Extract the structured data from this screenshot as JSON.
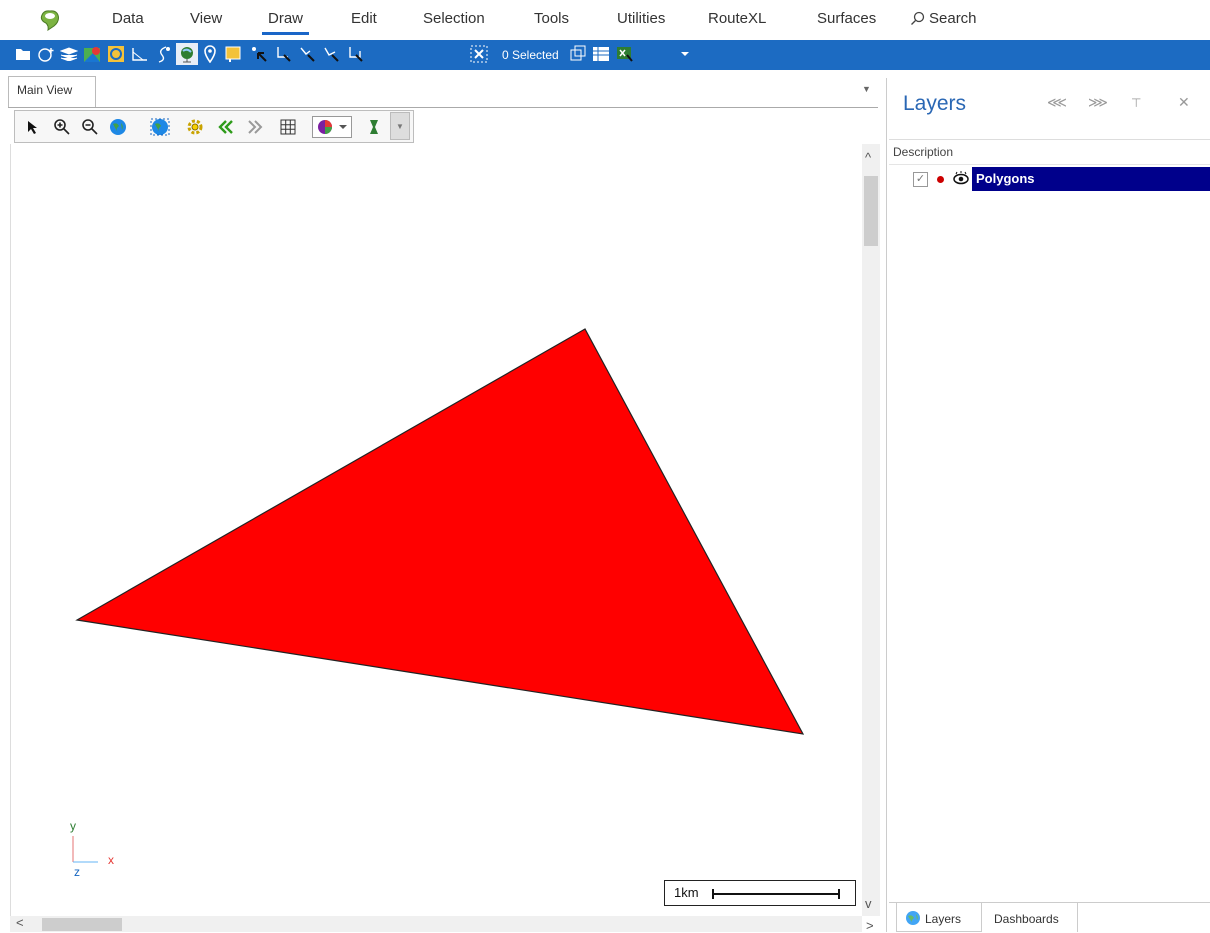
{
  "menu": {
    "items": [
      "Data",
      "View",
      "Draw",
      "Edit",
      "Selection",
      "Tools",
      "Utilities",
      "RouteXL",
      "Surfaces"
    ],
    "active": "Draw",
    "search_label": "Search"
  },
  "toolbar": {
    "selected_label": "0 Selected",
    "icons": [
      "open-folder-icon",
      "add-layer-icon",
      "layers-stack-icon",
      "map-pin-layer-icon",
      "frame-icon",
      "measure-icon",
      "route-icon",
      "globe-icon",
      "location-pin-icon",
      "polygon-tool-icon",
      "select-point-icon",
      "select-polyline-icon",
      "select-vertex-icon",
      "select-lasso-icon",
      "select-area-icon",
      "clear-selection-icon",
      "copy-selection-icon",
      "table-icon",
      "export-excel-icon",
      "toolbar-dropdown-icon"
    ]
  },
  "main_view": {
    "tab_label": "Main View",
    "map_tools": [
      "pointer-icon",
      "zoom-in-icon",
      "zoom-out-icon",
      "globe-zoom-icon",
      "globe-extent-icon",
      "settings-gear-icon",
      "back-icon",
      "forward-icon",
      "grid-icon",
      "basemap-icon",
      "style-icon"
    ],
    "axis": {
      "x": "x",
      "y": "y",
      "z": "z"
    },
    "scale_label": "1km",
    "polygon_color": "#ff0000"
  },
  "layers_panel": {
    "title": "Layers",
    "column_header": "Description",
    "layers": [
      {
        "name": "Polygons",
        "visible": true,
        "color": "#cc0000"
      }
    ],
    "bottom_tabs": [
      "Layers",
      "Dashboards"
    ]
  }
}
